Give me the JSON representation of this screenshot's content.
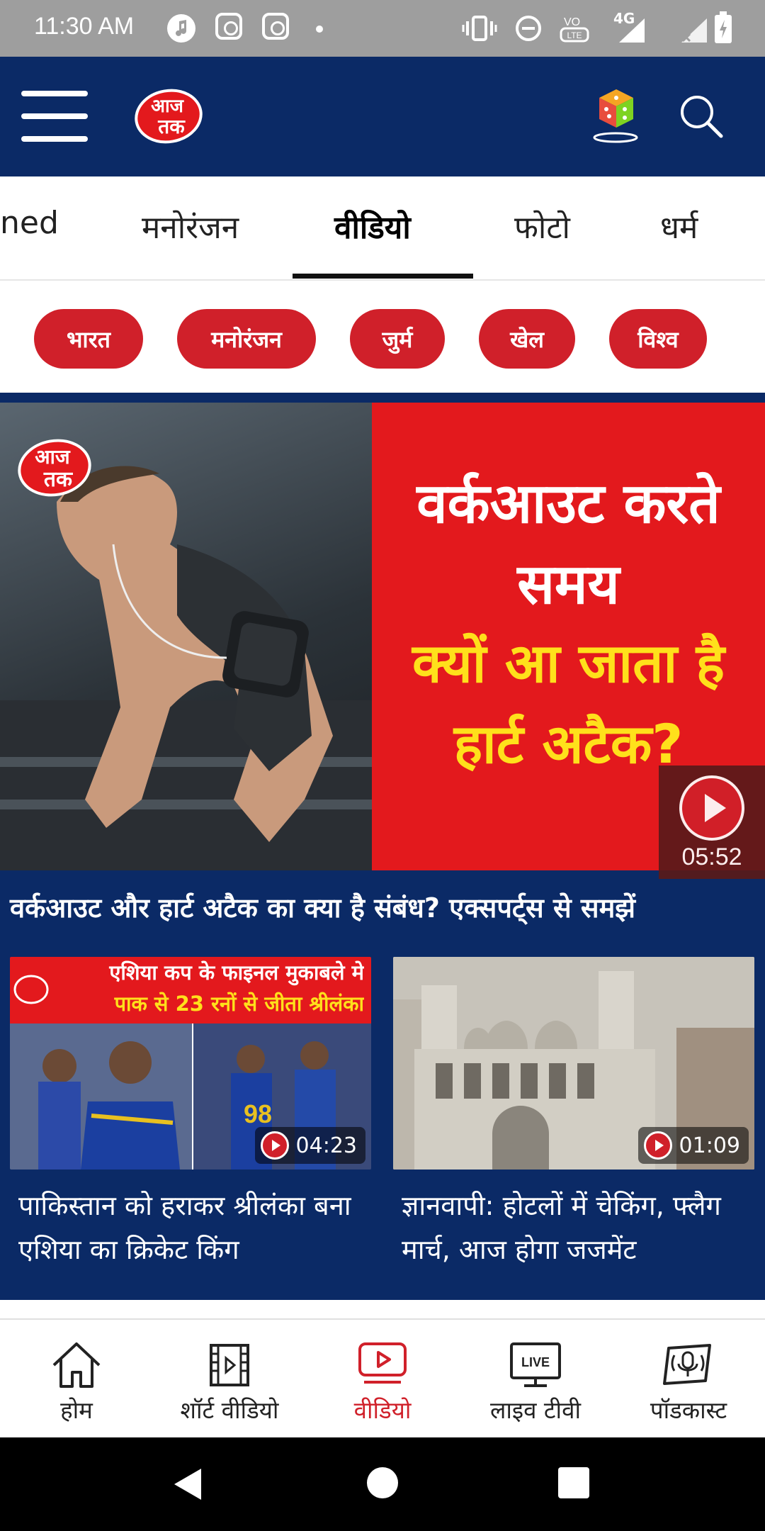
{
  "status_bar": {
    "time": "11:30 AM",
    "network": "4G"
  },
  "header": {
    "logo_text_top": "आज",
    "logo_text_bottom": "तक"
  },
  "tabs": [
    {
      "label": "ned"
    },
    {
      "label": "मनोरंजन"
    },
    {
      "label": "वीडियो",
      "active": true
    },
    {
      "label": "फोटो"
    },
    {
      "label": "धर्म"
    }
  ],
  "filters": [
    {
      "label": "भारत"
    },
    {
      "label": "मनोरंजन"
    },
    {
      "label": "जुर्म"
    },
    {
      "label": "खेल"
    },
    {
      "label": "विश्व"
    }
  ],
  "hero": {
    "overlay_line1": "वर्कआउट करते",
    "overlay_line2": "समय",
    "overlay_line3": "क्यों आ जाता है",
    "overlay_line4": "हार्ट अटैक?",
    "duration": "05:52",
    "caption": "वर्कआउट और हार्ट अटैक का क्या है संबंध? एक्सपर्ट्स से समझें"
  },
  "cards": [
    {
      "thumb_text_line1": "एशिया कप के फाइनल मुकाबले मे",
      "thumb_text_line2": "पाक से 23 रनों से जीता श्रीलंका",
      "duration": "04:23",
      "title": "पाकिस्तान को हराकर श्रीलंका बना एशिया का क्रिकेट किंग"
    },
    {
      "duration": "01:09",
      "title": "ज्ञानवापी: होटलों में चेकिंग, फ्लैग मार्च, आज होगा जजमेंट"
    }
  ],
  "bottom_nav": [
    {
      "label": "होम",
      "icon": "home-icon"
    },
    {
      "label": "शॉर्ट वीडियो",
      "icon": "film-icon"
    },
    {
      "label": "वीडियो",
      "icon": "video-play-icon",
      "active": true
    },
    {
      "label": "लाइव टीवी",
      "icon": "live-tv-icon",
      "live_badge": "LIVE"
    },
    {
      "label": "पॉडकास्ट",
      "icon": "podcast-icon"
    }
  ],
  "colors": {
    "navy": "#0b2a66",
    "red": "#d0202a",
    "hero_red": "#e3191d",
    "yellow": "#ffe01b"
  }
}
